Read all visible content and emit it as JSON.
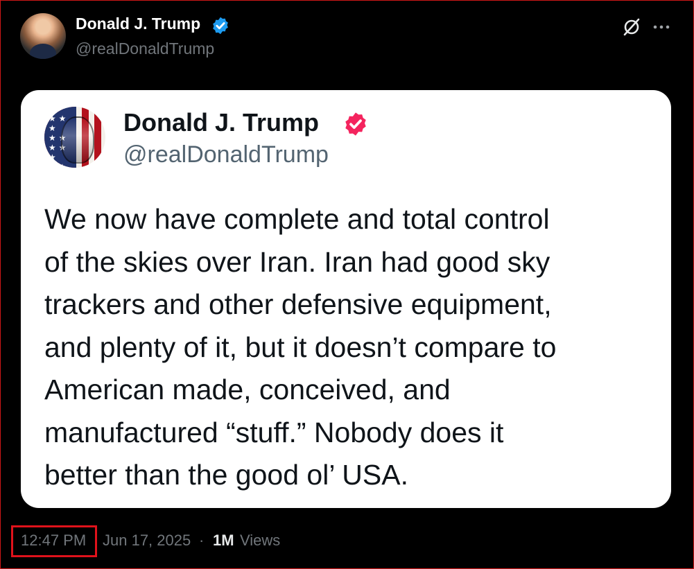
{
  "tweet": {
    "author_name": "Donald J. Trump",
    "author_handle": "@realDonaldTrump",
    "time": "12:47 PM",
    "date": "Jun 17, 2025",
    "separator": "·",
    "views_count": "1M",
    "views_label": "Views"
  },
  "quoted_post": {
    "author_name": "Donald J. Trump",
    "author_handle": "@realDonaldTrump",
    "lines": [
      "We now have complete and total control",
      "of the skies over Iran. Iran had good sky",
      "trackers and other defensive equipment,",
      "and plenty of it, but it doesn’t compare to",
      "American made, conceived, and",
      "manufactured “stuff.” Nobody does it",
      "better than the good ol’ USA."
    ]
  },
  "icons": {
    "verified_outer": "verified-badge-icon",
    "verified_inner": "verified-badge-icon",
    "grok": "grok-icon",
    "more": "more-icon"
  },
  "colors": {
    "background": "#000000",
    "card_background": "#ffffff",
    "verified_outer": "#1d9bf0",
    "verified_inner": "#f4245e",
    "highlight_border": "#e0121b",
    "muted_text": "#71767b"
  }
}
